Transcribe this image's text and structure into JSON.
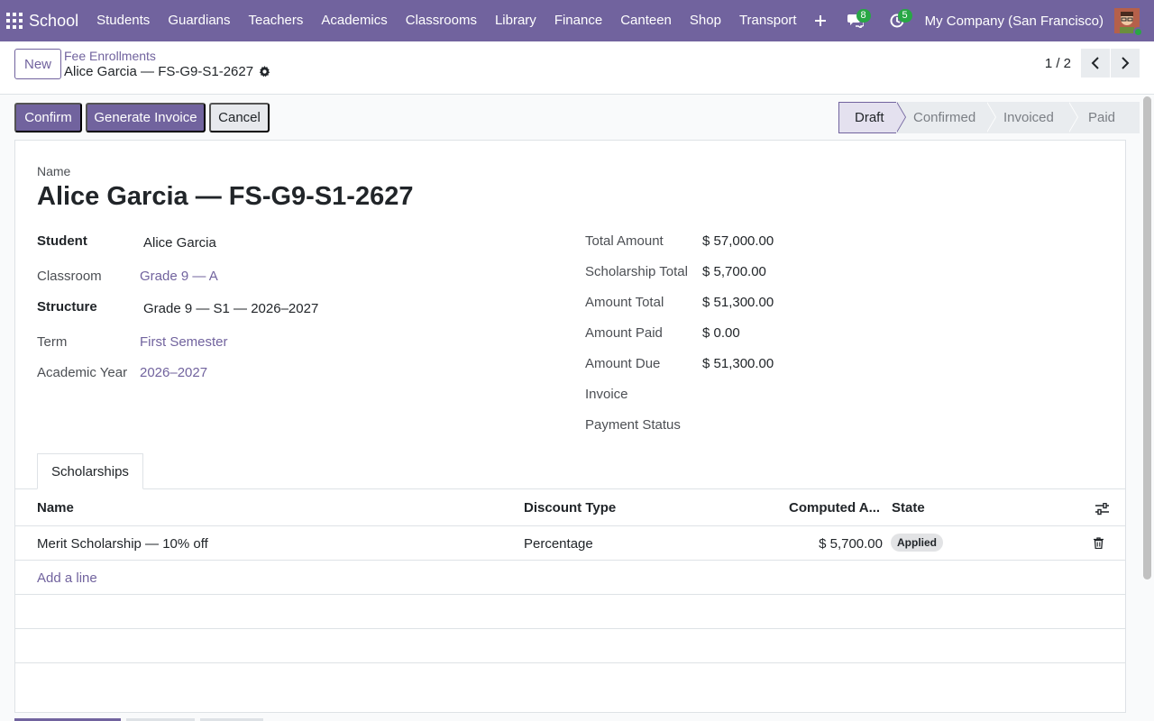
{
  "navbar": {
    "brand": "School",
    "menu": [
      "Students",
      "Guardians",
      "Teachers",
      "Academics",
      "Classrooms",
      "Library",
      "Finance",
      "Canteen",
      "Shop",
      "Transport"
    ],
    "messages_count": "8",
    "activities_count": "5",
    "company": "My Company (San Francisco)"
  },
  "control": {
    "new_label": "New",
    "breadcrumb": "Fee Enrollments",
    "record_title": "Alice Garcia — FS-G9-S1-2627",
    "pager": "1 / 2"
  },
  "actions": {
    "confirm": "Confirm",
    "generate_invoice": "Generate Invoice",
    "cancel": "Cancel"
  },
  "status": {
    "stages": [
      "Draft",
      "Confirmed",
      "Invoiced",
      "Paid"
    ],
    "active": "Draft"
  },
  "form": {
    "name_label": "Name",
    "name_value": "Alice Garcia — FS-G9-S1-2627",
    "left": {
      "student_label": "Student",
      "student_value": "Alice Garcia",
      "classroom_label": "Classroom",
      "classroom_value": "Grade 9 — A",
      "structure_label": "Structure",
      "structure_value": "Grade 9 — S1 — 2026–2027",
      "term_label": "Term",
      "term_value": "First Semester",
      "year_label": "Academic Year",
      "year_value": "2026–2027"
    },
    "right": {
      "total_label": "Total Amount",
      "total_value": "$ 57,000.00",
      "scholarship_label": "Scholarship Total",
      "scholarship_value": "$ 5,700.00",
      "amount_total_label": "Amount Total",
      "amount_total_value": "$ 51,300.00",
      "paid_label": "Amount Paid",
      "paid_value": "$ 0.00",
      "due_label": "Amount Due",
      "due_value": "$ 51,300.00",
      "invoice_label": "Invoice",
      "payment_status_label": "Payment Status"
    }
  },
  "scholarships": {
    "tab_label": "Scholarships",
    "columns": {
      "name": "Name",
      "discount_type": "Discount Type",
      "computed_amount": "Computed A...",
      "state": "State"
    },
    "rows": [
      {
        "name": "Merit Scholarship — 10% off",
        "discount_type": "Percentage",
        "computed_amount": "$ 5,700.00",
        "state": "Applied"
      }
    ],
    "add_line": "Add a line"
  },
  "colors": {
    "brand": "#71639e",
    "badge": "#28a745"
  }
}
